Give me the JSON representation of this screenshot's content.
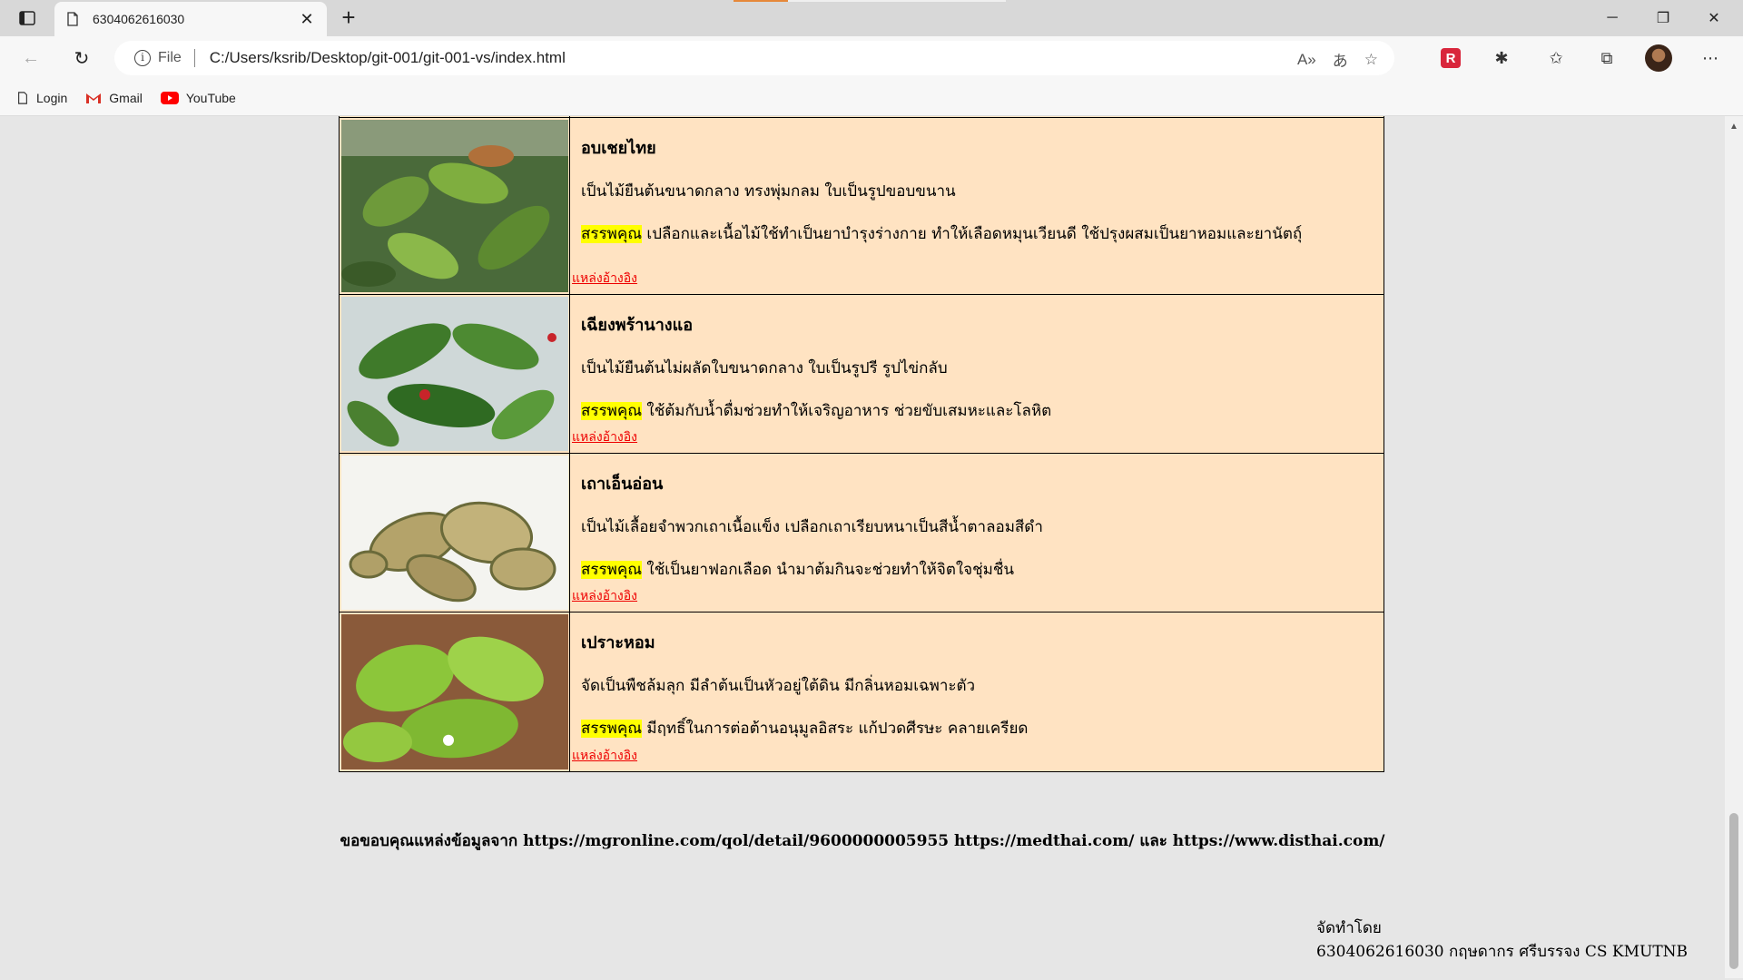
{
  "browser": {
    "tab_title": "6304062616030",
    "file_label": "File",
    "url": "C:/Users/ksrib/Desktop/git-001/git-001-vs/index.html",
    "bookmarks": [
      {
        "label": "Login",
        "icon": "page-icon"
      },
      {
        "label": "Gmail",
        "icon": "gmail-icon"
      },
      {
        "label": "YouTube",
        "icon": "youtube-icon"
      }
    ]
  },
  "herbs": [
    {
      "name": "อบเชยไทย",
      "description": "เป็นไม้ยืนต้นขนาดกลาง ทรงพุ่มกลม ใบเป็นรูปขอบขนาน",
      "benefit_label": "สรรพคุณ",
      "benefit": " เปลือกและเนื้อไม้ใช้ทำเป็นยาบำรุงร่างกาย ทำให้เลือดหมุนเวียนดี ใช้ปรุงผสมเป็นยาหอมและยานัตถุ์",
      "ref_label": "แหล่งอ้างอิง"
    },
    {
      "name": "เฉียงพร้านางแอ",
      "description": "เป็นไม้ยืนต้นไม่ผลัดใบขนาดกลาง ใบเป็นรูปรี รูปไข่กลับ",
      "benefit_label": "สรรพคุณ",
      "benefit": " ใช้ต้มกับน้ำดื่มช่วยทำให้เจริญอาหาร ช่วยขับเสมหะและโลหิต",
      "ref_label": "แหล่งอ้างอิง"
    },
    {
      "name": "เถาเอ็นอ่อน",
      "description": "เป็นไม้เลื้อยจำพวกเถาเนื้อแข็ง เปลือกเถาเรียบหนาเป็นสีน้ำตาลอมสีดำ",
      "benefit_label": "สรรพคุณ",
      "benefit": " ใช้เป็นยาฟอกเลือด นำมาต้มกินจะช่วยทำให้จิตใจชุ่มชื่น",
      "ref_label": "แหล่งอ้างอิง"
    },
    {
      "name": "เปราะหอม",
      "description": "จัดเป็นพืชล้มลุก มีลำต้นเป็นหัวอยู่ใต้ดิน มีกลิ่นหอมเฉพาะตัว",
      "benefit_label": "สรรพคุณ",
      "benefit": " มีฤทธิ์ในการต่อต้านอนุมูลอิสระ แก้ปวดศีรษะ คลายเครียด",
      "ref_label": "แหล่งอ้างอิง"
    }
  ],
  "credits": "ขอขอบคุณแหล่งข้อมูลจาก https://mgronline.com/qol/detail/9600000005955 https://medthai.com/ และ https://www.disthai.com/",
  "footer": {
    "made_by": "จัดทำโดย",
    "author": "6304062616030 กฤษดากร ศรีบรรจง CS KMUTNB"
  },
  "colors": {
    "table_bg": "#ffe3c2",
    "highlight": "#ffff00",
    "link": "#ee0000"
  }
}
